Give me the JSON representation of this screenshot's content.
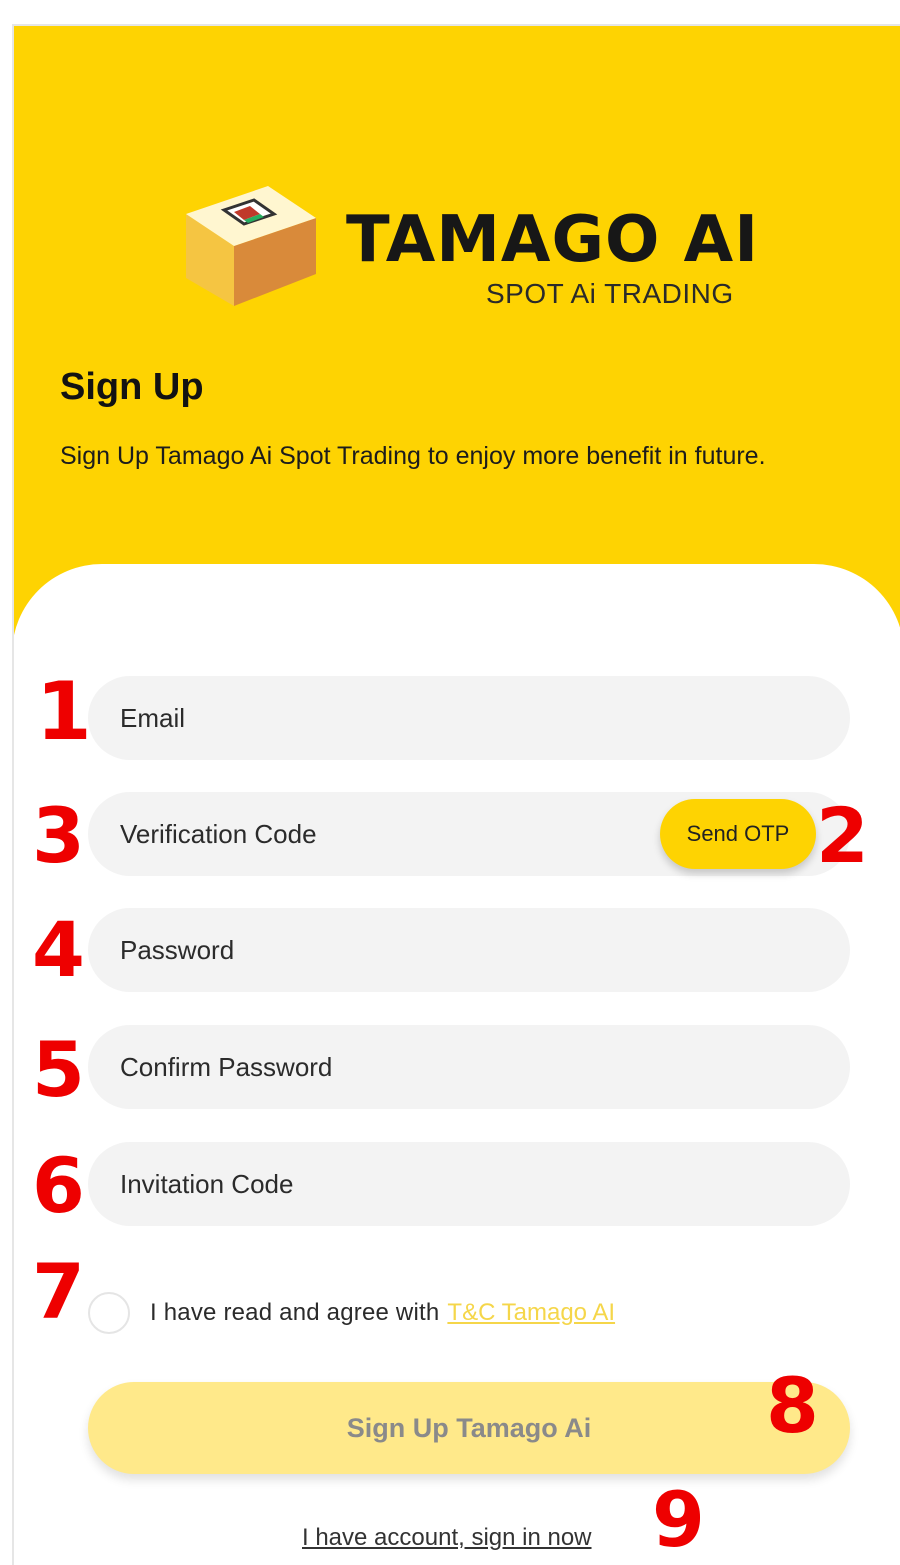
{
  "brand": {
    "name": "TAMAGO AI",
    "tagline": "SPOT Ai TRADING"
  },
  "header": {
    "title": "Sign Up",
    "subtitle": "Sign Up Tamago Ai Spot Trading to enjoy more benefit in future."
  },
  "form": {
    "email_placeholder": "Email",
    "verification_placeholder": "Verification Code",
    "send_otp_label": "Send OTP",
    "password_placeholder": "Password",
    "confirm_password_placeholder": "Confirm Password",
    "invitation_placeholder": "Invitation Code",
    "agree_text": "I have read and agree with",
    "terms_link": "T&C Tamago AI",
    "submit_label": "Sign Up Tamago Ai",
    "signin_link": "I have account, sign in now"
  },
  "annotations": [
    "1",
    "2",
    "3",
    "4",
    "5",
    "6",
    "7",
    "8",
    "9"
  ],
  "colors": {
    "brand_yellow": "#fed302",
    "field_bg": "#f3f3f3",
    "button_disabled": "#ffe98a",
    "annotation_red": "#ee0000"
  }
}
